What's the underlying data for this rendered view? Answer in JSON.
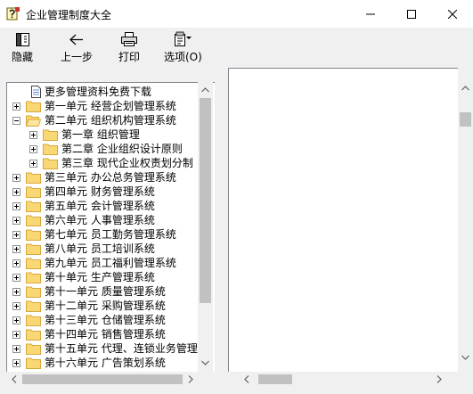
{
  "window": {
    "title": "企业管理制度大全"
  },
  "toolbar": {
    "hide_label": "隐藏",
    "back_label": "上一步",
    "print_label": "打印",
    "options_label": "选项(O)"
  },
  "tree": {
    "items": [
      {
        "label": "更多管理资料免费下载",
        "type": "doc"
      },
      {
        "label": "第一单元  经营企划管理系统",
        "type": "folder",
        "state": "collapsed"
      },
      {
        "label": "第二单元  组织机构管理系统",
        "type": "folder",
        "state": "expanded"
      },
      {
        "label": "第一章  组织管理",
        "type": "folder",
        "state": "collapsed"
      },
      {
        "label": "第二章  企业组织设计原则",
        "type": "folder",
        "state": "collapsed"
      },
      {
        "label": "第三章  现代企业权责划分制",
        "type": "folder",
        "state": "collapsed"
      },
      {
        "label": "第三单元 办公总务管理系统",
        "type": "folder",
        "state": "collapsed"
      },
      {
        "label": "第四单元 财务管理系统",
        "type": "folder",
        "state": "collapsed"
      },
      {
        "label": "第五单元 会计管理系统",
        "type": "folder",
        "state": "collapsed"
      },
      {
        "label": "第六单元 人事管理系统",
        "type": "folder",
        "state": "collapsed"
      },
      {
        "label": "第七单元 员工勤务管理系统",
        "type": "folder",
        "state": "collapsed"
      },
      {
        "label": "第八单元 员工培训系统",
        "type": "folder",
        "state": "collapsed"
      },
      {
        "label": "第九单元 员工福利管理系统",
        "type": "folder",
        "state": "collapsed"
      },
      {
        "label": "第十单元 生产管理系统",
        "type": "folder",
        "state": "collapsed"
      },
      {
        "label": "第十一单元 质量管理系统",
        "type": "folder",
        "state": "collapsed"
      },
      {
        "label": "第十二单元 采购管理系统",
        "type": "folder",
        "state": "collapsed"
      },
      {
        "label": "第十三单元 仓储管理系统",
        "type": "folder",
        "state": "collapsed"
      },
      {
        "label": "第十四单元 销售管理系统",
        "type": "folder",
        "state": "collapsed"
      },
      {
        "label": "第十五单元 代理、连锁业务管理",
        "type": "folder",
        "state": "collapsed"
      },
      {
        "label": "第十六单元 广告策划系统",
        "type": "folder",
        "state": "collapsed"
      }
    ]
  },
  "colors": {
    "folder_fill": "#f8d775",
    "folder_edge": "#d8a93a",
    "selection": "#0078d7"
  },
  "icons": {
    "app": "help-icon",
    "hide": "hide-pane-icon",
    "back": "back-arrow-icon",
    "print": "printer-icon",
    "options": "options-icon"
  }
}
